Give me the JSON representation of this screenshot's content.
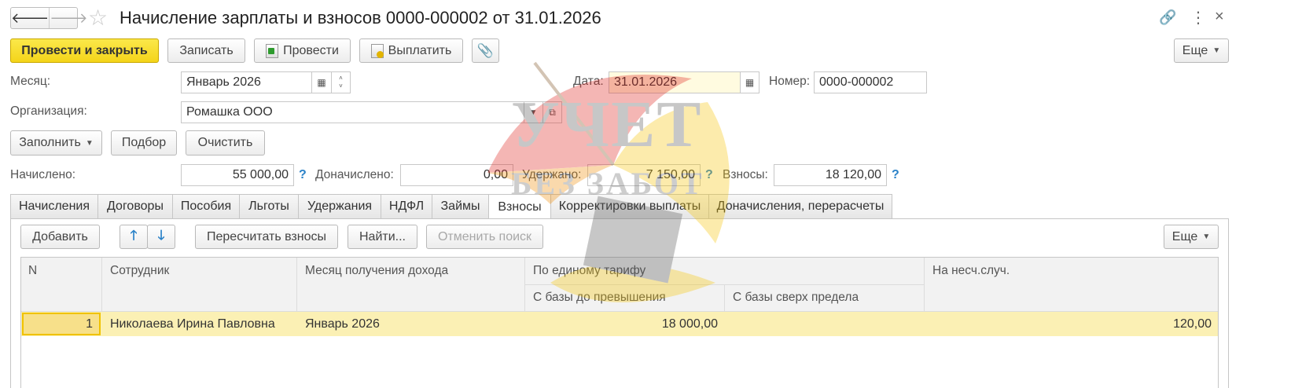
{
  "header": {
    "title": "Начисление зарплаты и взносов 0000-000002 от 31.01.2026"
  },
  "toolbar": {
    "post_close": "Провести и закрыть",
    "save": "Записать",
    "post": "Провести",
    "pay": "Выплатить",
    "more": "Еще"
  },
  "form": {
    "month_label": "Месяц:",
    "month_value": "Январь 2026",
    "date_label": "Дата:",
    "date_value": "31.01.2026",
    "number_label": "Номер:",
    "number_value": "0000-000002",
    "org_label": "Организация:",
    "org_value": "Ромашка ООО"
  },
  "actions": {
    "fill": "Заполнить",
    "select": "Подбор",
    "clear": "Очистить"
  },
  "totals": {
    "accrued_label": "Начислено:",
    "accrued_value": "55 000,00",
    "extra_label": "Доначислено:",
    "extra_value": "0,00",
    "withheld_label": "Удержано:",
    "withheld_value": "7 150,00",
    "contrib_label": "Взносы:",
    "contrib_value": "18 120,00",
    "help_mark": "?"
  },
  "tabs": [
    {
      "label": "Начисления"
    },
    {
      "label": "Договоры"
    },
    {
      "label": "Пособия"
    },
    {
      "label": "Льготы"
    },
    {
      "label": "Удержания"
    },
    {
      "label": "НДФЛ"
    },
    {
      "label": "Займы"
    },
    {
      "label": "Взносы"
    },
    {
      "label": "Корректировки выплаты"
    },
    {
      "label": "Доначисления, перерасчеты"
    }
  ],
  "table_toolbar": {
    "add": "Добавить",
    "recalc": "Пересчитать взносы",
    "find": "Найти...",
    "cancel_search": "Отменить поиск",
    "more": "Еще"
  },
  "table": {
    "col_n": "N",
    "col_employee": "Сотрудник",
    "col_month": "Месяц получения дохода",
    "col_unified": "По единому тарифу",
    "col_base_below": "С базы до превышения",
    "col_base_above": "С базы сверх предела",
    "col_accident": "На несч.случ.",
    "rows": [
      {
        "n": "1",
        "employee": "Николаева Ирина Павловна",
        "month": "Январь 2026",
        "base_below": "18 000,00",
        "base_above": "",
        "accident": "120,00"
      }
    ]
  },
  "watermark": {
    "line1": "УЧЕТ",
    "line2": "БЕЗ ЗАБОТ"
  }
}
